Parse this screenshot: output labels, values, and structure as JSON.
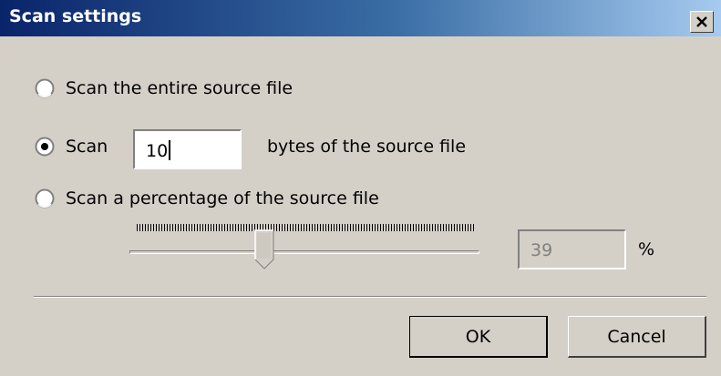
{
  "window": {
    "title": "Scan settings",
    "close_icon": "close-icon"
  },
  "options": {
    "entire_label": "Scan the entire source file",
    "bytes_prefix_label": "Scan",
    "bytes_value": "10",
    "bytes_suffix_label": "bytes of the source file",
    "percentage_label": "Scan a percentage of the source file",
    "selected": "bytes"
  },
  "slider": {
    "value_percent": 39,
    "display_value": "39",
    "unit_label": "%"
  },
  "buttons": {
    "ok_label": "OK",
    "cancel_label": "Cancel"
  },
  "colors": {
    "dialog_bg": "#d4d0c8",
    "titlebar_start": "#0a246a",
    "titlebar_end": "#a6caf0"
  }
}
